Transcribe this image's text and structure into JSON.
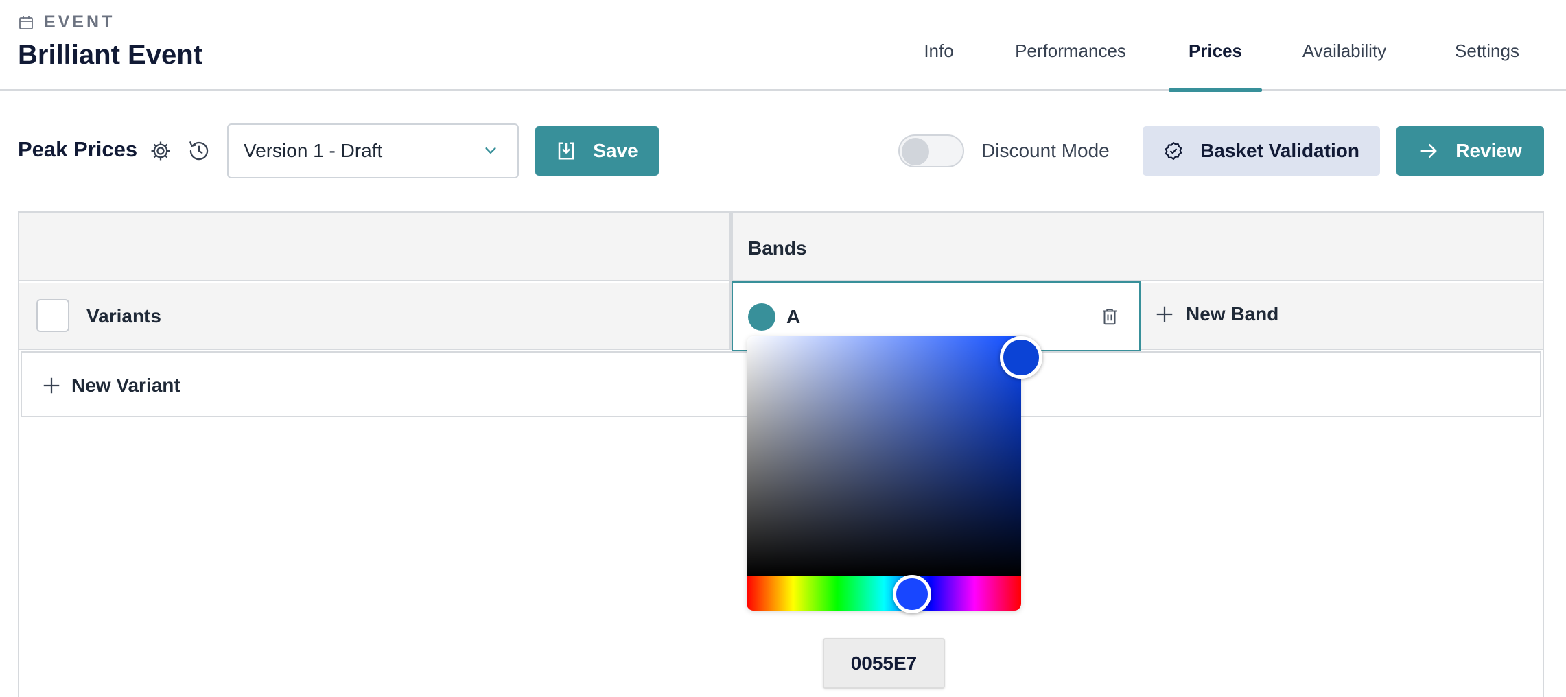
{
  "header": {
    "eyebrow": "EVENT",
    "title": "Brilliant Event",
    "tabs": [
      {
        "label": "Info",
        "active": false
      },
      {
        "label": "Performances",
        "active": false
      },
      {
        "label": "Prices",
        "active": true
      },
      {
        "label": "Availability",
        "active": false
      },
      {
        "label": "Settings",
        "active": false
      }
    ]
  },
  "toolbar": {
    "title": "Peak Prices",
    "version_select": "Version 1 - Draft",
    "save_label": "Save",
    "discount_mode_label": "Discount Mode",
    "discount_mode_on": false,
    "basket_validation_label": "Basket Validation",
    "review_label": "Review"
  },
  "grid": {
    "bands_header": "Bands",
    "variants_header": "Variants",
    "bands": [
      {
        "name": "A",
        "color": "#38909a"
      }
    ],
    "new_band_label": "New Band",
    "new_variant_label": "New Variant"
  },
  "color_picker": {
    "hex_value": "0055E7",
    "selected_color": "#0055E7"
  },
  "colors": {
    "accent": "#38909a",
    "title": "#111a35",
    "soft_button": "#dde3f0"
  }
}
